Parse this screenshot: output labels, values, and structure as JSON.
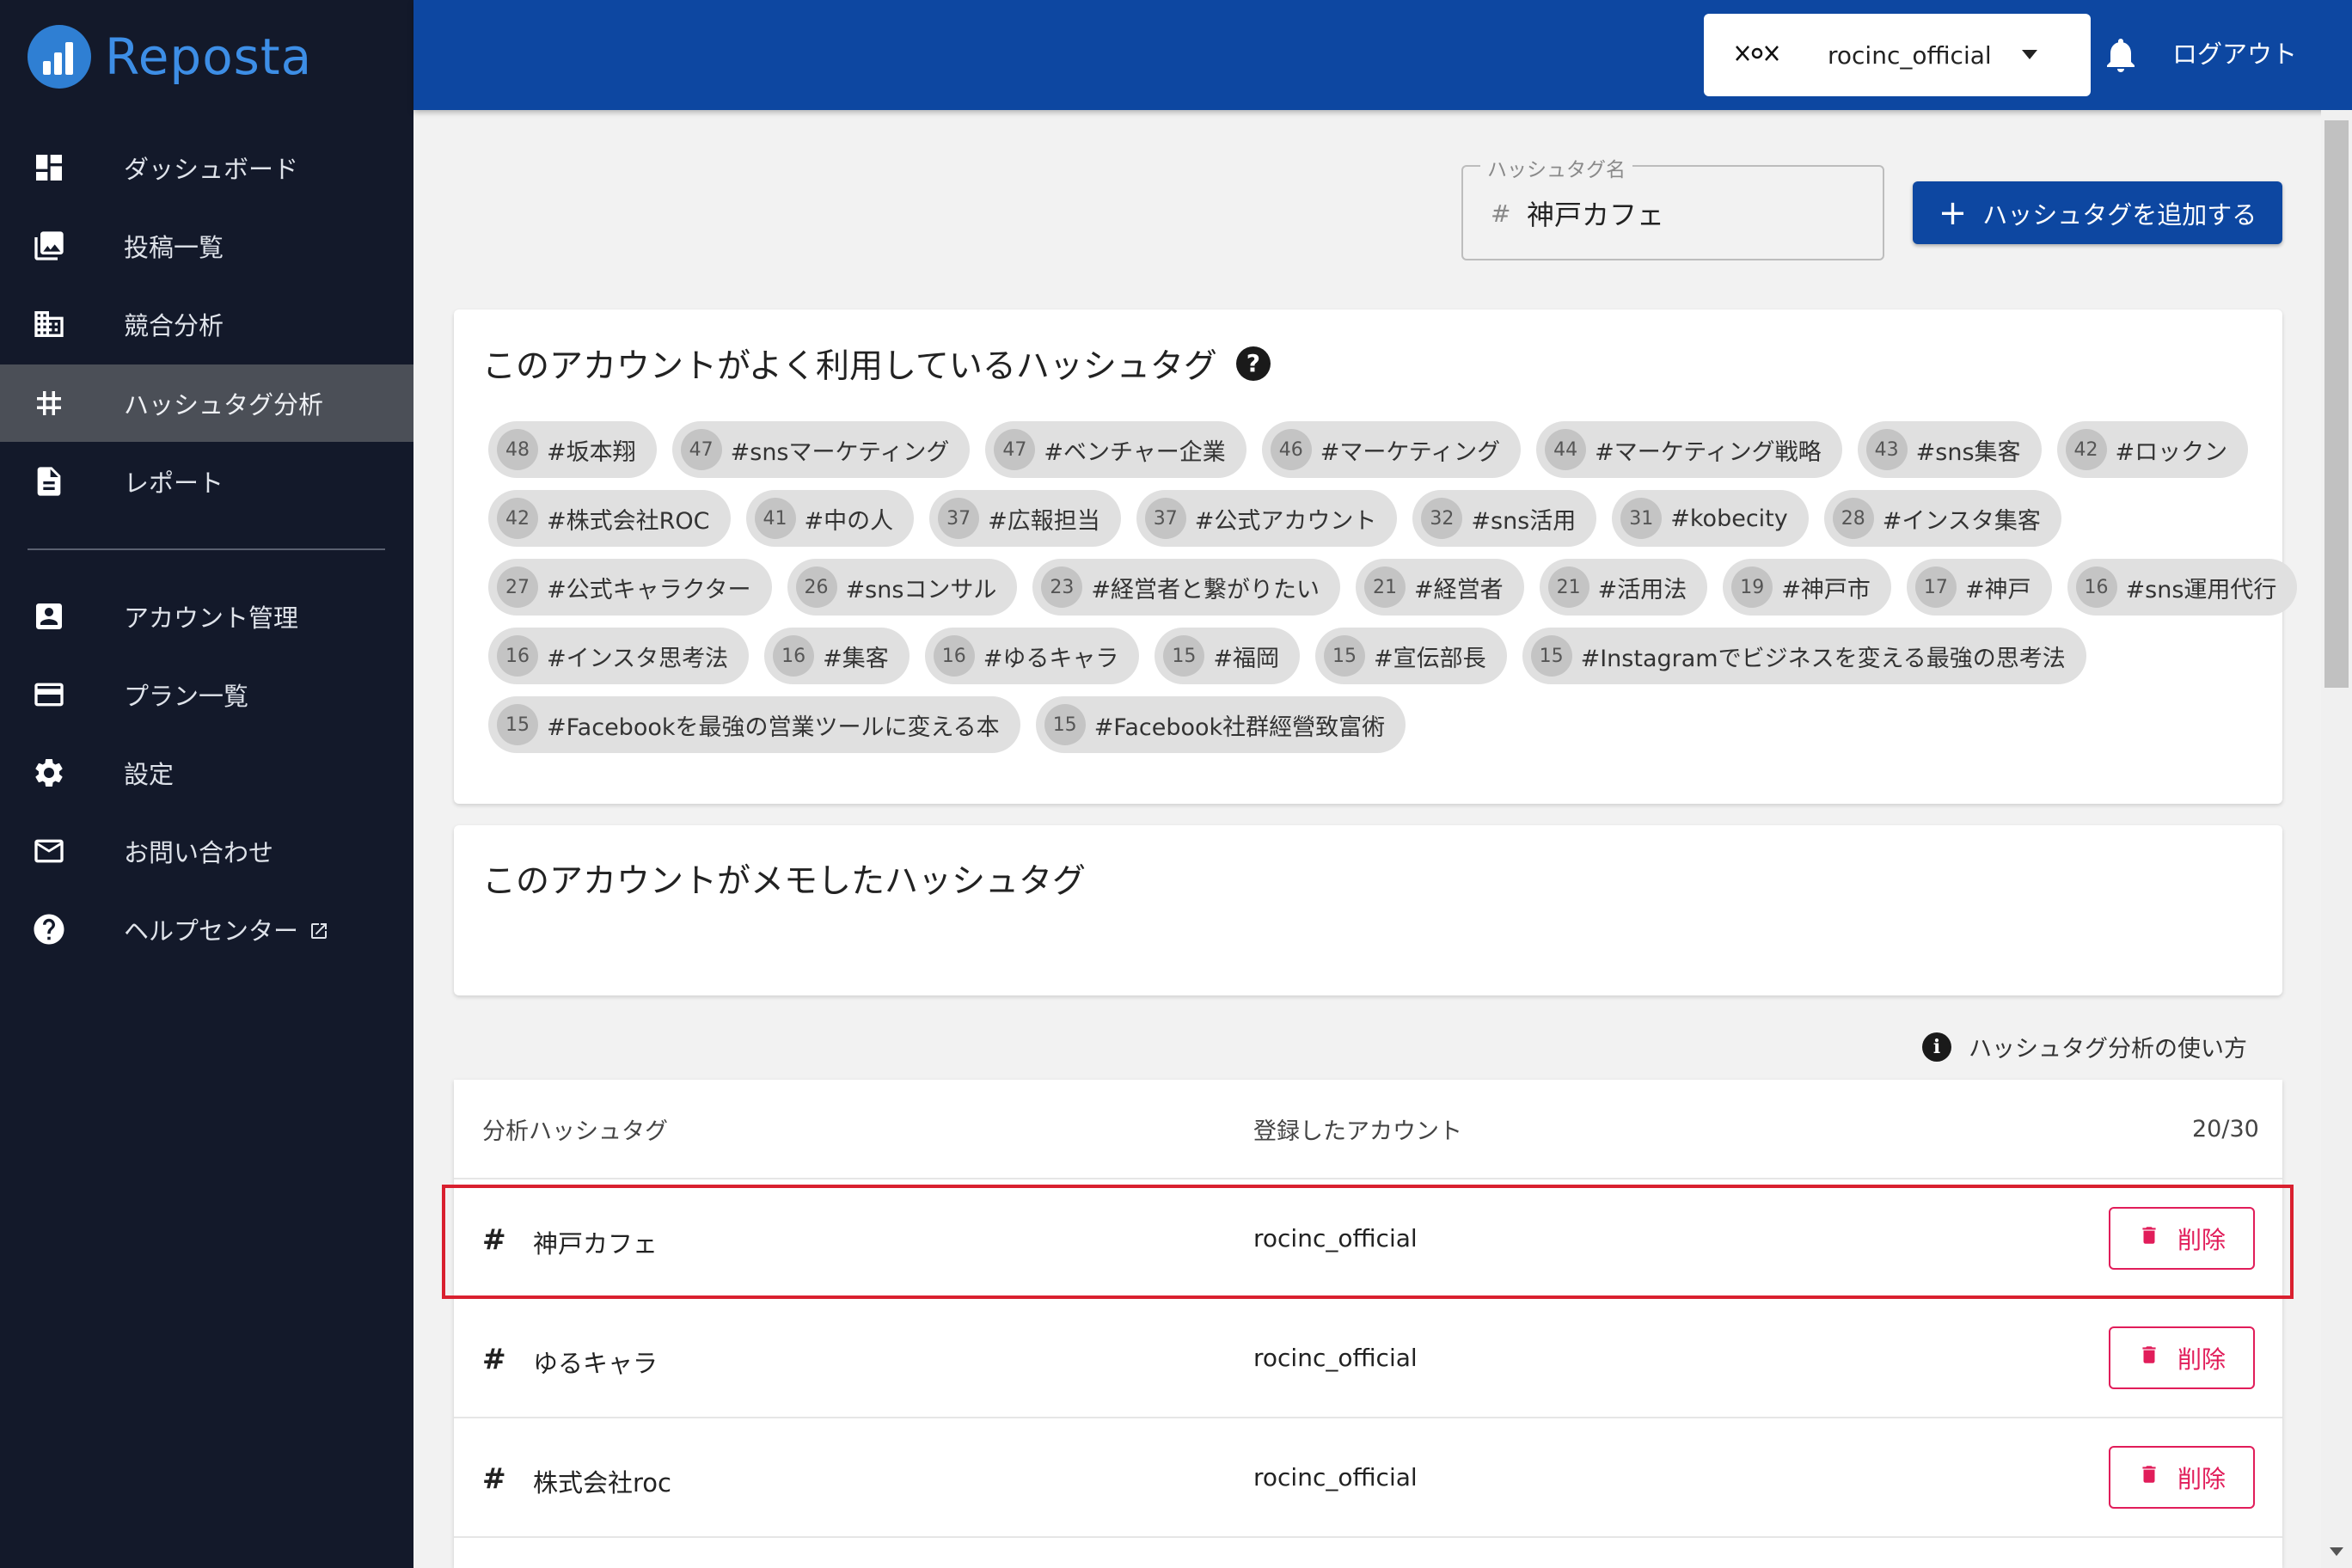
{
  "app": {
    "name": "Reposta"
  },
  "sidebar": {
    "items": [
      {
        "label": "ダッシュボード",
        "icon": "dashboard-icon"
      },
      {
        "label": "投稿一覧",
        "icon": "photo-library-icon"
      },
      {
        "label": "競合分析",
        "icon": "building-icon"
      },
      {
        "label": "ハッシュタグ分析",
        "icon": "hashtag-icon",
        "active": true
      },
      {
        "label": "レポート",
        "icon": "document-icon"
      }
    ],
    "secondary": [
      {
        "label": "アカウント管理",
        "icon": "account-box-icon"
      },
      {
        "label": "プラン一覧",
        "icon": "credit-card-icon"
      },
      {
        "label": "設定",
        "icon": "gear-icon"
      },
      {
        "label": "お問い合わせ",
        "icon": "mail-icon"
      },
      {
        "label": "ヘルプセンター",
        "icon": "help-icon"
      }
    ]
  },
  "header": {
    "account": "rocinc_official",
    "logout": "ログアウト"
  },
  "search": {
    "legend": "ハッシュタグ名",
    "hash": "#",
    "value": "神戸カフェ"
  },
  "add_button": {
    "label": "ハッシュタグを追加する",
    "plus": "+"
  },
  "popular": {
    "title": "このアカウントがよく利用しているハッシュタグ",
    "help": "?",
    "rows": [
      [
        {
          "count": "48",
          "tag": "#坂本翔"
        },
        {
          "count": "47",
          "tag": "#snsマーケティング"
        },
        {
          "count": "47",
          "tag": "#ベンチャー企業"
        },
        {
          "count": "46",
          "tag": "#マーケティング"
        },
        {
          "count": "44",
          "tag": "#マーケティング戦略"
        },
        {
          "count": "43",
          "tag": "#sns集客"
        },
        {
          "count": "42",
          "tag": "#ロックン"
        }
      ],
      [
        {
          "count": "42",
          "tag": "#株式会社ROC"
        },
        {
          "count": "41",
          "tag": "#中の人"
        },
        {
          "count": "37",
          "tag": "#広報担当"
        },
        {
          "count": "37",
          "tag": "#公式アカウント"
        },
        {
          "count": "32",
          "tag": "#sns活用"
        },
        {
          "count": "31",
          "tag": "#kobecity"
        },
        {
          "count": "28",
          "tag": "#インスタ集客"
        }
      ],
      [
        {
          "count": "27",
          "tag": "#公式キャラクター"
        },
        {
          "count": "26",
          "tag": "#snsコンサル"
        },
        {
          "count": "23",
          "tag": "#経営者と繋がりたい"
        },
        {
          "count": "21",
          "tag": "#経営者"
        },
        {
          "count": "21",
          "tag": "#活用法"
        },
        {
          "count": "19",
          "tag": "#神戸市"
        },
        {
          "count": "17",
          "tag": "#神戸"
        },
        {
          "count": "16",
          "tag": "#sns運用代行"
        }
      ],
      [
        {
          "count": "16",
          "tag": "#インスタ思考法"
        },
        {
          "count": "16",
          "tag": "#集客"
        },
        {
          "count": "16",
          "tag": "#ゆるキャラ"
        },
        {
          "count": "15",
          "tag": "#福岡"
        },
        {
          "count": "15",
          "tag": "#宣伝部長"
        },
        {
          "count": "15",
          "tag": "#Instagramでビジネスを変える最強の思考法"
        }
      ],
      [
        {
          "count": "15",
          "tag": "#Facebookを最強の営業ツールに変える本"
        },
        {
          "count": "15",
          "tag": "#Facebook社群經營致富術"
        }
      ]
    ]
  },
  "memo": {
    "title": "このアカウントがメモしたハッシュタグ"
  },
  "usage": {
    "icon_glyph": "i",
    "label": "ハッシュタグ分析の使い方"
  },
  "table": {
    "headers": {
      "tag": "分析ハッシュタグ",
      "account": "登録したアカウント",
      "count": "20/30"
    },
    "hash": "#",
    "rows": [
      {
        "tag": "神戸カフェ",
        "account": "rocinc_official",
        "action": "削除"
      },
      {
        "tag": "ゆるキャラ",
        "account": "rocinc_official",
        "action": "削除"
      },
      {
        "tag": "株式会社roc",
        "account": "rocinc_official",
        "action": "削除"
      }
    ]
  },
  "colors": {
    "sidebar": "#13192a",
    "header": "#0d47a1",
    "primary": "#0d47a1",
    "danger": "#e11d5a",
    "highlight": "#d9202f"
  }
}
